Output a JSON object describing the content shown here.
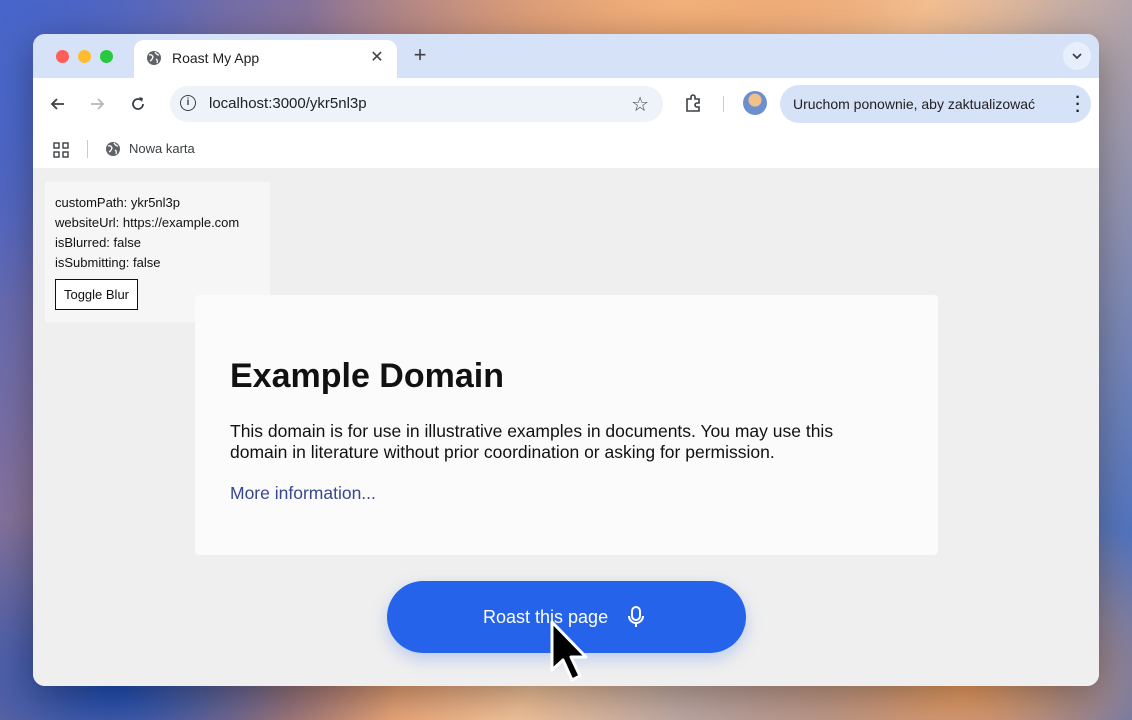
{
  "tab": {
    "title": "Roast My App"
  },
  "toolbar": {
    "url": "localhost:3000/ykr5nl3p",
    "update_label": "Uruchom ponownie, aby zaktualizować"
  },
  "bookmarks": {
    "items": [
      {
        "label": "Nowa karta"
      }
    ]
  },
  "debug": {
    "lines": [
      "customPath: ykr5nl3p",
      "websiteUrl: https://example.com",
      "isBlurred: false",
      "isSubmitting: false"
    ],
    "toggle_label": "Toggle Blur"
  },
  "card": {
    "title": "Example Domain",
    "text": "This domain is for use in illustrative examples in documents. You may use this domain in literature without prior coordination or asking for permission.",
    "link": "More information..."
  },
  "cta": {
    "label": "Roast this page",
    "icon": "microphone-icon"
  },
  "colors": {
    "accent": "#2563eb",
    "tab_strip": "#d6e2f8",
    "link": "#38488f"
  }
}
